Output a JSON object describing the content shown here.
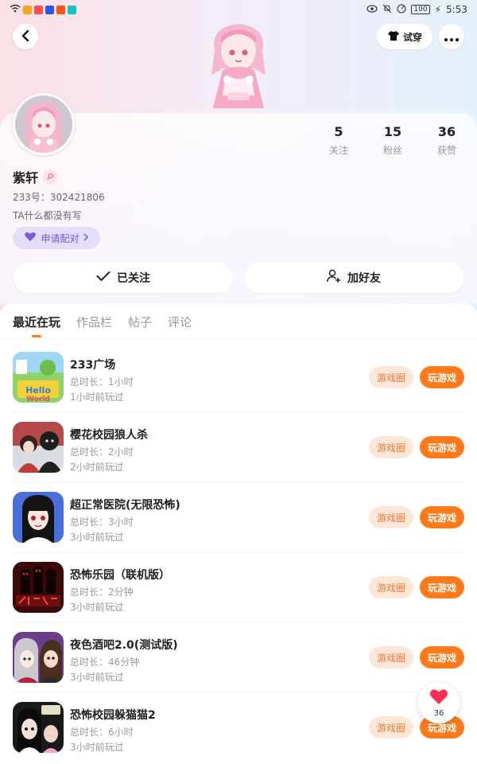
{
  "status_bar": {
    "time": "5:53",
    "battery": "100"
  },
  "header": {
    "tryon_label": "试穿"
  },
  "profile": {
    "name": "紫轩",
    "uid": "233号：302421806",
    "bio": "TA什么都没有写",
    "pair_label": "申请配对",
    "stats": [
      {
        "value": "5",
        "label": "关注"
      },
      {
        "value": "15",
        "label": "粉丝"
      },
      {
        "value": "36",
        "label": "获赞"
      }
    ],
    "follow_label": "已关注",
    "add_friend_label": "加好友"
  },
  "tabs": [
    {
      "label": "最近在玩"
    },
    {
      "label": "作品栏"
    },
    {
      "label": "帖子"
    },
    {
      "label": "评论"
    }
  ],
  "games": [
    {
      "name": "233广场",
      "duration": "总时长：1小时",
      "last": "1小时前玩过",
      "circle_label": "游戏圈",
      "play_label": "玩游戏"
    },
    {
      "name": "樱花校园狼人杀",
      "duration": "总时长：2小时",
      "last": "2小时前玩过",
      "circle_label": "游戏圈",
      "play_label": "玩游戏"
    },
    {
      "name": "超正常医院(无限恐怖)",
      "duration": "总时长：3小时",
      "last": "3小时前玩过",
      "circle_label": "游戏圈",
      "play_label": "玩游戏"
    },
    {
      "name": "恐怖乐园（联机版）",
      "duration": "总时长：2分钟",
      "last": "3小时前玩过",
      "circle_label": "游戏圈",
      "play_label": "玩游戏"
    },
    {
      "name": "夜色酒吧2.0(测试版)",
      "duration": "总时长：46分钟",
      "last": "3小时前玩过",
      "circle_label": "游戏圈",
      "play_label": "玩游戏"
    },
    {
      "name": "恐怖校园躲猫猫2",
      "duration": "总时长：6小时",
      "last": "3小时前玩过",
      "circle_label": "游戏圈",
      "play_label": "玩游戏"
    }
  ],
  "like_float": {
    "count": "36"
  },
  "colors": {
    "accent": "#ff7a1a",
    "pair": "#6e5bd6"
  }
}
